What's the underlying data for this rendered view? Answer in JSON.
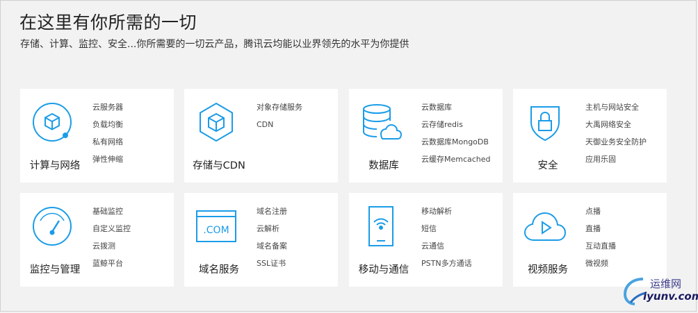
{
  "header": {
    "title": "在这里有你所需的一切",
    "subtitle": "存储、计算、监控、安全...你所需要的一切云产品，腾讯云均能以业界领先的水平为你提供"
  },
  "accent_color": "#1a9ce8",
  "cards": [
    {
      "name": "计算与网络",
      "icon": "cube-circle-icon",
      "items": [
        "云服务器",
        "负载均衡",
        "私有网络",
        "弹性伸缩"
      ]
    },
    {
      "name": "存储与CDN",
      "icon": "cube-hexagon-icon",
      "items": [
        "对象存储服务",
        "CDN"
      ]
    },
    {
      "name": "数据库",
      "icon": "database-cloud-icon",
      "items": [
        "云数据库",
        "云存储redis",
        "云数据库MongoDB",
        "云缓存Memcached"
      ]
    },
    {
      "name": "安全",
      "icon": "shield-lock-icon",
      "items": [
        "主机与网站安全",
        "大禹网络安全",
        "天御业务安全防护",
        "应用乐固"
      ]
    },
    {
      "name": "监控与管理",
      "icon": "gauge-icon",
      "items": [
        "基础监控",
        "自定义监控",
        "云拨测",
        "蓝鲸平台"
      ]
    },
    {
      "name": "域名服务",
      "icon": "browser-com-icon",
      "items": [
        "域名注册",
        "云解析",
        "域名备案",
        "SSL证书"
      ]
    },
    {
      "name": "移动与通信",
      "icon": "phone-wifi-icon",
      "items": [
        "移动解析",
        "短信",
        "云通信",
        "PSTN多方通话"
      ]
    },
    {
      "name": "视频服务",
      "icon": "cloud-play-icon",
      "items": [
        "点播",
        "直播",
        "互动直播",
        "微视频"
      ]
    }
  ],
  "watermark": {
    "name": "运维网",
    "url": "iyunv.com"
  }
}
